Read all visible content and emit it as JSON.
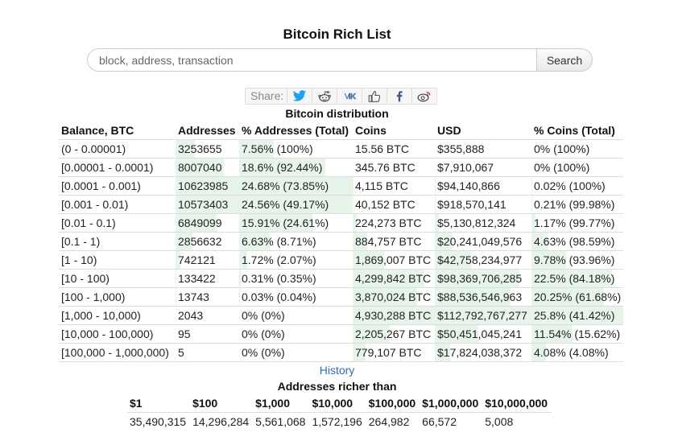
{
  "title": "Bitcoin Rich List",
  "search": {
    "placeholder": "block, address, transaction",
    "button_label": "Search"
  },
  "share": {
    "label": "Share:",
    "buttons": [
      {
        "name": "twitter-icon",
        "color": "#1da1f2"
      },
      {
        "name": "reddit-icon",
        "color": "#333333"
      },
      {
        "name": "vk-icon",
        "color": "#4a76a8"
      },
      {
        "name": "like-icon",
        "color": "#555555"
      },
      {
        "name": "facebook-icon",
        "color": "#3b5998"
      },
      {
        "name": "weibo-icon",
        "color": "#e6162d"
      }
    ]
  },
  "distribution": {
    "caption": "Bitcoin distribution",
    "headers": [
      "Balance, BTC",
      "Addresses",
      "% Addresses (Total)",
      "Coins",
      "USD",
      "% Coins (Total)"
    ],
    "bar_color": "#e6f4ea",
    "rows": [
      {
        "balance": "(0 - 0.00001)",
        "addresses": "3253655",
        "pct_addresses": "7.56% (100%)",
        "coins": "15.56 BTC",
        "usd": "$355,888",
        "pct_coins": "0% (100%)",
        "addr_share": 0.3075,
        "pctaddr_share": 0.3076,
        "coins_share": 0.0,
        "usd_share": 0.0,
        "pctcoins_share": 0.0
      },
      {
        "balance": "[0.00001 - 0.0001)",
        "addresses": "8007040",
        "pct_addresses": "18.6% (92.44%)",
        "coins": "345.76 BTC",
        "usd": "$7,910,067",
        "pct_coins": "0% (100%)",
        "addr_share": 0.7572,
        "pctaddr_share": 0.7573,
        "coins_share": 0.0,
        "usd_share": 0.0,
        "pctcoins_share": 0.0
      },
      {
        "balance": "[0.0001 - 0.001)",
        "addresses": "10623985",
        "pct_addresses": "24.68% (73.85%)",
        "coins": "4,115 BTC",
        "usd": "$94,140,866",
        "pct_coins": "0.02% (100%)",
        "addr_share": 1.0,
        "pctaddr_share": 1.0,
        "coins_share": 0.0008,
        "usd_share": 0.0008,
        "pctcoins_share": 0.0008
      },
      {
        "balance": "[0.001 - 0.01)",
        "addresses": "10573403",
        "pct_addresses": "24.56% (49.17%)",
        "coins": "40,152 BTC",
        "usd": "$918,570,141",
        "pct_coins": "0.21% (99.98%)",
        "addr_share": 0.9951,
        "pctaddr_share": 0.9951,
        "coins_share": 0.0081,
        "usd_share": 0.0081,
        "pctcoins_share": 0.0081
      },
      {
        "balance": "[0.01 - 0.1)",
        "addresses": "6849099",
        "pct_addresses": "15.91% (24.61%)",
        "coins": "224,273 BTC",
        "usd": "$5,130,812,324",
        "pct_coins": "1.17% (99.77%)",
        "addr_share": 0.6447,
        "pctaddr_share": 0.6446,
        "coins_share": 0.0455,
        "usd_share": 0.0455,
        "pctcoins_share": 0.0453
      },
      {
        "balance": "[0.1 - 1)",
        "addresses": "2856632",
        "pct_addresses": "6.63% (8.71%)",
        "coins": "884,757 BTC",
        "usd": "$20,241,049,576",
        "pct_coins": "4.63% (98.59%)",
        "addr_share": 0.2689,
        "pctaddr_share": 0.2686,
        "coins_share": 0.1795,
        "usd_share": 0.1795,
        "pctcoins_share": 0.1795
      },
      {
        "balance": "[1 - 10)",
        "addresses": "742121",
        "pct_addresses": "1.72% (2.07%)",
        "coins": "1,869,007 BTC",
        "usd": "$42,758,234,977",
        "pct_coins": "9.78% (93.96%)",
        "addr_share": 0.0699,
        "pctaddr_share": 0.0697,
        "coins_share": 0.3791,
        "usd_share": 0.3791,
        "pctcoins_share": 0.3791
      },
      {
        "balance": "[10 - 100)",
        "addresses": "133422",
        "pct_addresses": "0.31% (0.35%)",
        "coins": "4,299,842 BTC",
        "usd": "$98,369,706,285",
        "pct_coins": "22.5% (84.18%)",
        "addr_share": 0.0126,
        "pctaddr_share": 0.0126,
        "coins_share": 0.8721,
        "usd_share": 0.8721,
        "pctcoins_share": 0.8721
      },
      {
        "balance": "[100 - 1,000)",
        "addresses": "13743",
        "pct_addresses": "0.03% (0.04%)",
        "coins": "3,870,024 BTC",
        "usd": "$88,536,546,963",
        "pct_coins": "20.25% (61.68%)",
        "addr_share": 0.0013,
        "pctaddr_share": 0.0012,
        "coins_share": 0.785,
        "usd_share": 0.785,
        "pctcoins_share": 0.7849
      },
      {
        "balance": "[1,000 - 10,000)",
        "addresses": "2043",
        "pct_addresses": "0% (0%)",
        "coins": "4,930,288 BTC",
        "usd": "$112,792,767,277",
        "pct_coins": "25.8% (41.42%)",
        "addr_share": 0.0002,
        "pctaddr_share": 0.0,
        "coins_share": 1.0,
        "usd_share": 1.0,
        "pctcoins_share": 1.0
      },
      {
        "balance": "[10,000 - 100,000)",
        "addresses": "95",
        "pct_addresses": "0% (0%)",
        "coins": "2,205,267 BTC",
        "usd": "$50,451,045,241",
        "pct_coins": "11.54% (15.62%)",
        "addr_share": 0.0,
        "pctaddr_share": 0.0,
        "coins_share": 0.4473,
        "usd_share": 0.4473,
        "pctcoins_share": 0.4473
      },
      {
        "balance": "[100,000 - 1,000,000)",
        "addresses": "5",
        "pct_addresses": "0% (0%)",
        "coins": "779,107 BTC",
        "usd": "$17,824,038,372",
        "pct_coins": "4.08% (4.08%)",
        "addr_share": 0.0,
        "pctaddr_share": 0.0,
        "coins_share": 0.158,
        "usd_share": 0.158,
        "pctcoins_share": 0.1581
      }
    ]
  },
  "history_link": "History",
  "richer": {
    "caption": "Addresses richer than",
    "headers": [
      "$1",
      "$100",
      "$1,000",
      "$10,000",
      "$100,000",
      "$1,000,000",
      "$10,000,000"
    ],
    "values": [
      "35,490,315",
      "14,296,284",
      "5,561,068",
      "1,572,196",
      "264,982",
      "66,572",
      "5,008"
    ]
  }
}
